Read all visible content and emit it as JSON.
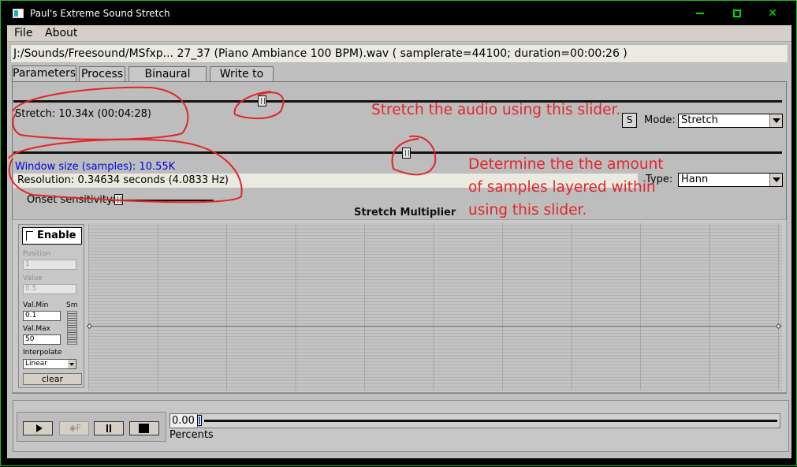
{
  "window": {
    "title": "Paul's Extreme Sound Stretch",
    "minimize_label": "",
    "maximize_label": "",
    "close_label": "✕"
  },
  "menu": {
    "file": "File",
    "about": "About"
  },
  "file_info": "J:/Sounds/Freesound/MSfxp... 27_37 (Piano Ambiance 100 BPM).wav ( samplerate=44100; duration=00:00:26 )",
  "tabs": [
    "Parameters",
    "Process",
    "Binaural beats",
    "Write to file"
  ],
  "parameters": {
    "stretch_label": "Stretch: 10.34x (00:04:28)",
    "s_button": "S",
    "mode_label": "Mode:",
    "mode_value": "Stretch",
    "window_size_label": "Window size (samples): 10.55K",
    "resolution_label": "Resolution: 0.34634 seconds (4.0833 Hz)",
    "type_label": "Type:",
    "type_value": "Hann",
    "onset_label": "Onset sensitivity:"
  },
  "stretch_multiplier": {
    "title": "Stretch Multiplier",
    "enable_label": "Enable",
    "position_label": "Position",
    "position_value": "1",
    "value_label": "Value",
    "value_value": "0.5",
    "valmin_label": "Val.Min",
    "valmin_value": "0.1",
    "valmax_label": "Val.Max",
    "valmax_value": "50",
    "sm_label": "Sm",
    "interpolate_label": "Interpolate",
    "interpolate_value": "Linear",
    "clear_label": "clear"
  },
  "transport": {
    "freeze_label": "F",
    "position_value": "0.00",
    "percents_label": "Percents"
  },
  "annotations": {
    "note1": "Stretch the audio using this slider.",
    "note2": "Determine the the amount of samples layered within using this slider."
  },
  "colors": {
    "window_border": "#1fbd1f",
    "annotation_red": "#e0262a",
    "window_size_blue": "#0000e6"
  }
}
